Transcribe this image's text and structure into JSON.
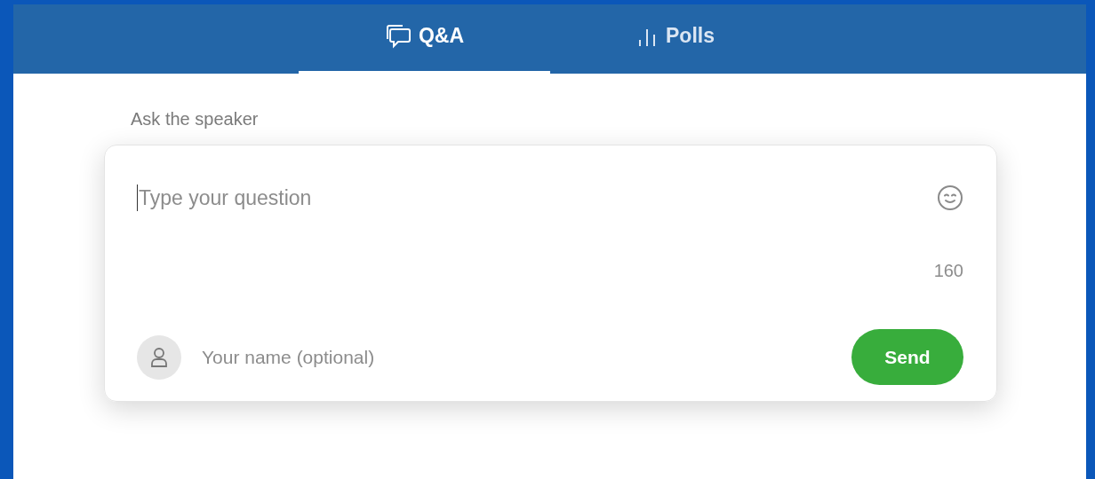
{
  "tabs": [
    {
      "kind": "chat",
      "label": "Q&A",
      "selected": true
    },
    {
      "kind": "chart",
      "label": "Polls",
      "selected": false
    }
  ],
  "form": {
    "label": "Ask the speaker",
    "question": {
      "placeholder": "Type your question"
    },
    "char_count": "160",
    "name": {
      "placeholder": "Your name (optional)"
    },
    "send_button": "Send"
  }
}
